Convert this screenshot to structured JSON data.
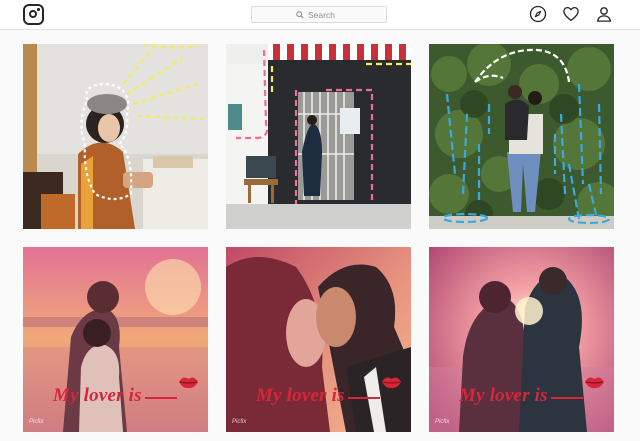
{
  "header": {
    "logo_icon": "instagram-logo-icon",
    "search": {
      "placeholder": "Search",
      "icon": "search-icon"
    },
    "nav_icons": [
      "compass-icon",
      "heart-icon",
      "person-icon"
    ]
  },
  "posts": [
    {
      "id": 1,
      "description": ""
    },
    {
      "id": 2,
      "description": ""
    },
    {
      "id": 3,
      "description": ""
    },
    {
      "id": 4,
      "caption": "My lover is",
      "watermark": "Picfix",
      "icon": "lips-icon"
    },
    {
      "id": 5,
      "caption": "My lover is",
      "watermark": "Picfix",
      "icon": "lips-icon"
    },
    {
      "id": 6,
      "caption": "My lover is",
      "watermark": "Picfix",
      "icon": "lips-icon"
    }
  ],
  "colors": {
    "caption_red": "#d8253a",
    "doodle_yellow": "#f4ec5c",
    "doodle_pink": "#f06a9a",
    "doodle_blue": "#39a9e0",
    "doodle_white": "#ffffff"
  }
}
